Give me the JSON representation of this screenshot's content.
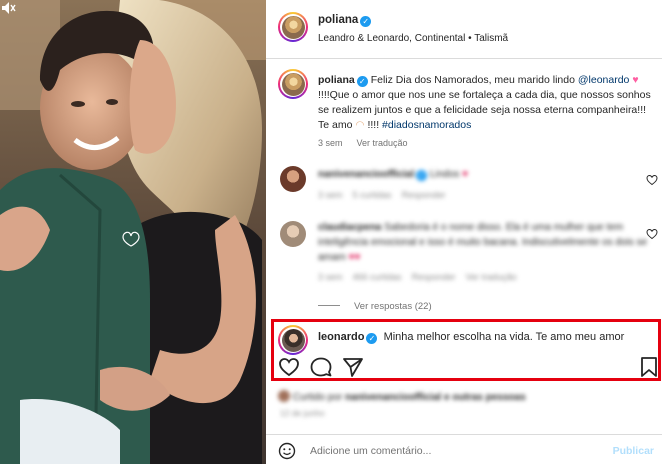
{
  "post": {
    "author": "poliana",
    "location": "Leandro & Leonardo, Continental • Talismã",
    "caption": {
      "author": "poliana",
      "text_1": "Feliz Dia dos Namorados, meu marido lindo",
      "mention": "@leonardo",
      "text_2": "!!!!Que o amor que nos une se fortaleça a cada dia, que nossos sonhos se realizem juntos e que a felicidade seja nossa eterna companheira!!! Te amo",
      "text_3": "!!!!",
      "hashtag": "#diadosnamorados",
      "time": "3 sem",
      "translate": "Ver tradução"
    }
  },
  "comments": [
    {
      "user": "nanivenancioofficial",
      "text": "Lindos",
      "time": "3 sem",
      "likes": "5 curtidas",
      "reply": "Responder"
    },
    {
      "user": "claudiacpena",
      "text": "Sabedoria é o nome disso. Ela é uma mulher que tem inteligência emocional e isso é muito bacana. Indiscutivelmente os dois se amam",
      "time": "3 sem",
      "likes": "466 curtidas",
      "reply": "Responder",
      "translate": "Ver tradução"
    }
  ],
  "view_replies": "Ver respostas (22)",
  "highlight": {
    "user": "leonardo",
    "text": "Minha melhor escolha na vida. Te amo meu amor"
  },
  "liked_by": {
    "prefix": "Curtido por",
    "user": "nanivenancioofficial",
    "suffix": "e outras pessoas"
  },
  "post_date": "12 de junho",
  "add_comment": {
    "placeholder": "Adicione um comentário...",
    "publish": "Publicar"
  },
  "colors": {
    "highlight_border": "#e5000f",
    "link": "#00376b",
    "verified": "#1d9bf0",
    "heart": "#e0245e"
  }
}
